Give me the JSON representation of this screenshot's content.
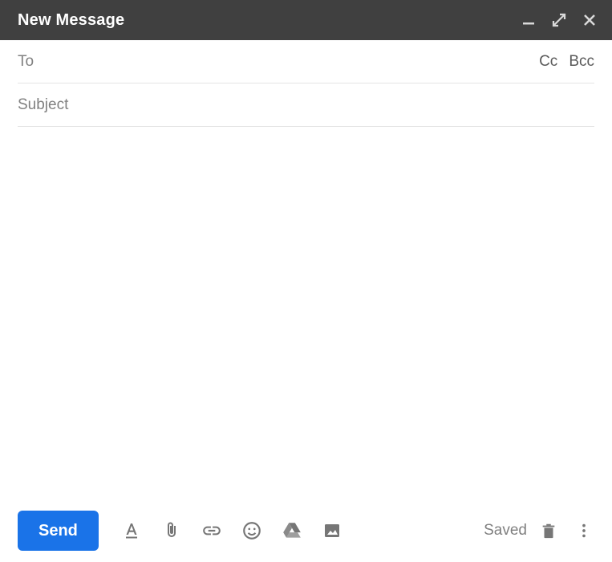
{
  "titlebar": {
    "title": "New Message"
  },
  "fields": {
    "to_label": "To",
    "cc_label": "Cc",
    "bcc_label": "Bcc",
    "subject_label": "Subject"
  },
  "toolbar": {
    "send_label": "Send",
    "status_label": "Saved"
  }
}
